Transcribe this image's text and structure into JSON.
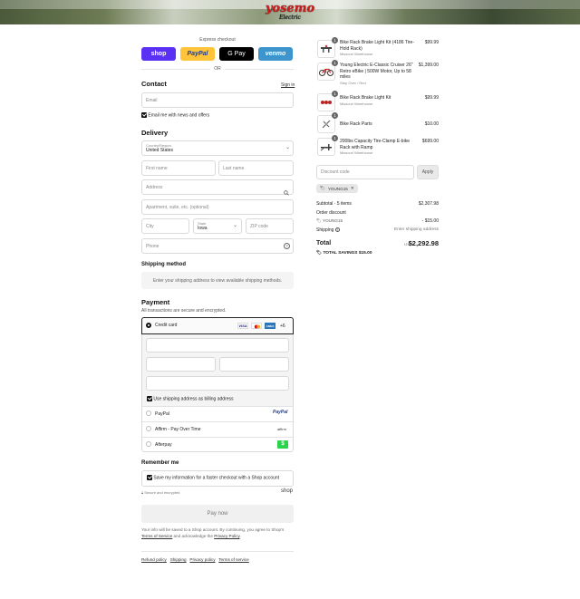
{
  "brand": {
    "logo_text": "yosemo",
    "logo_sub": "Electric"
  },
  "express": {
    "label": "Express checkout",
    "or": "OR",
    "shop": "shop",
    "paypal": "PayPal",
    "gpay": "G Pay",
    "venmo": "venmo"
  },
  "contact": {
    "heading": "Contact",
    "signin": "Sign in",
    "email_placeholder": "Email",
    "news_label": "Email me with news and offers"
  },
  "delivery": {
    "heading": "Delivery",
    "country_label": "Country/Region",
    "country_value": "United States",
    "first_name": "First name",
    "last_name": "Last name",
    "address": "Address",
    "apartment": "Apartment, suite, etc. (optional)",
    "city": "City",
    "state_label": "State",
    "state_value": "Iowa",
    "zip": "ZIP code",
    "phone": "Phone"
  },
  "shipping_method": {
    "heading": "Shipping method",
    "message": "Enter your shipping address to view available shipping methods."
  },
  "payment": {
    "heading": "Payment",
    "sub": "All transactions are secure and encrypted.",
    "credit_card": "Credit card",
    "card_more": "+6",
    "use_shipping": "Use shipping address as billing address",
    "paypal": "PayPal",
    "affirm": "Affirm - Pay Over Time",
    "afterpay": "Afterpay",
    "paypal_logo": "PayPal",
    "affirm_logo": "affirm"
  },
  "remember": {
    "heading": "Remember me",
    "save_label": "Save my information for a faster checkout with a Shop account",
    "secure": "Secure and encrypted",
    "shop": "shop"
  },
  "pay_now": "Pay now",
  "legal": {
    "text1": "Your info will be saved to a Shop account. By continuing, you agree to Shop's",
    "terms": "Terms of Service",
    "text2": "and acknowledge the",
    "privacy": "Privacy Policy",
    "end": "."
  },
  "footer": [
    "Refund policy",
    "Shipping",
    "Privacy policy",
    "Terms of service"
  ],
  "cart": {
    "items": [
      {
        "qty": "1",
        "name": "Bike Rack Brake Light Kit (4186 Tire-Hold Rack)",
        "sub": "Missouri Warehouse",
        "price": "$99.99"
      },
      {
        "qty": "1",
        "name": "Young Electric E-Classic Cruiser 26\" Retro eBike | 500W Motor, Up to 58 miles",
        "sub": "Step Over / Red",
        "price": "$1,399.00"
      },
      {
        "qty": "1",
        "name": "Bike Rack Brake Light Kit",
        "sub": "Missouri Warehouse",
        "price": "$99.99"
      },
      {
        "qty": "1",
        "name": "Bike Rack Parts",
        "sub": "",
        "price": "$10.00"
      },
      {
        "qty": "1",
        "name": "200lbs Capacity Tire-Clamp E-bike Rack with Ramp",
        "sub": "Missouri Warehouse",
        "price": "$699.00"
      }
    ],
    "discount_placeholder": "Discount code",
    "apply": "Apply",
    "code": "YOUNG15",
    "subtotal_label": "Subtotal · 5 items",
    "subtotal": "$2,307.98",
    "order_discount": "Order discount",
    "code_line": "YOUNG15",
    "discount_value": "- $15.00",
    "shipping_label": "Shipping",
    "shipping_value": "Enter shipping address",
    "total_label": "Total",
    "currency": "USD",
    "total": "$2,292.98",
    "savings_label": "TOTAL SAVINGS",
    "savings": "$15.00"
  }
}
